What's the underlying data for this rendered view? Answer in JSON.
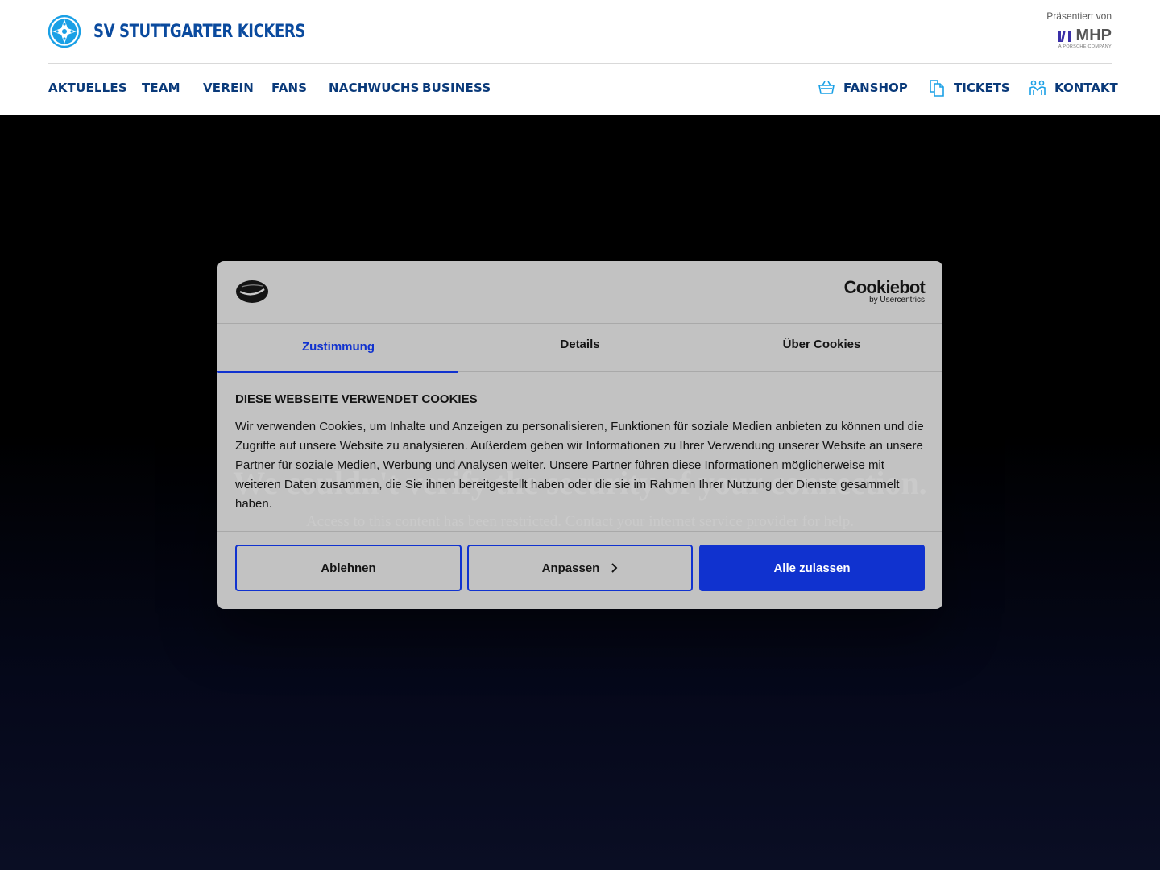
{
  "header": {
    "brand_name": "SV STUTTGARTER KICKERS",
    "sponsor_label": "Präsentiert von",
    "sponsor_name": "MHP",
    "sponsor_sub": "A PORSCHE COMPANY",
    "nav": [
      "AKTUELLES",
      "TEAM",
      "VEREIN",
      "FANS",
      "NACHWUCHS",
      "BUSINESS"
    ],
    "nav_right": [
      {
        "label": "FANSHOP",
        "icon": "basket-icon"
      },
      {
        "label": "TICKETS",
        "icon": "tickets-icon"
      },
      {
        "label": "KONTAKT",
        "icon": "contact-icon"
      }
    ],
    "colors": {
      "brand": "#0a4a9e",
      "nav": "#0a3a7a",
      "logo": "#1aa0e6"
    }
  },
  "hero": {
    "title": "We couldn't verify the security of your connection.",
    "subtitle": "Access to this content has been restricted. Contact your internet service provider for help."
  },
  "cookie": {
    "brand_name": "Cookiebot",
    "brand_sub": "by Usercentrics",
    "tabs": [
      "Zustimmung",
      "Details",
      "Über Cookies"
    ],
    "active_tab": "Zustimmung",
    "heading": "DIESE WEBSEITE VERWENDET COOKIES",
    "text": "Wir verwenden Cookies, um Inhalte und Anzeigen zu personalisieren, Funktionen für soziale Medien anbieten zu können und die Zugriffe auf unsere Website zu analysieren. Außerdem geben wir Informationen zu Ihrer Verwendung unserer Website an unsere Partner für soziale Medien, Werbung und Analysen weiter. Unsere Partner führen diese Informationen möglicherweise mit weiteren Daten zusammen, die Sie ihnen bereitgestellt haben oder die sie im Rahmen Ihrer Nutzung der Dienste gesammelt haben.",
    "buttons": {
      "decline": "Ablehnen",
      "customize": "Anpassen",
      "accept": "Alle zulassen"
    },
    "colors": {
      "accent": "#1032cf"
    }
  }
}
